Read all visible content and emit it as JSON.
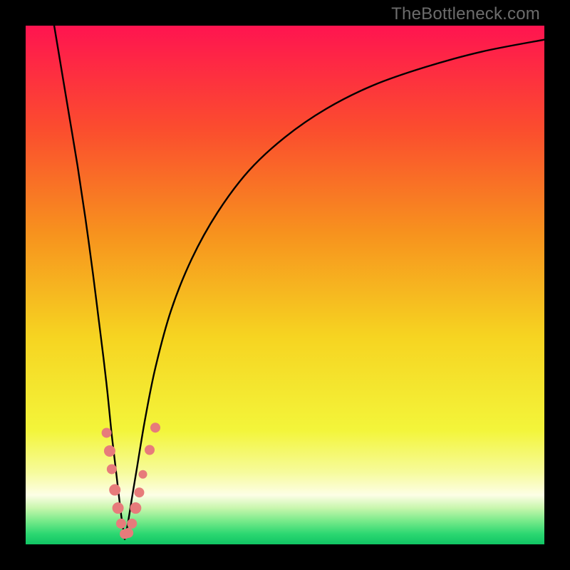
{
  "watermark": "TheBottleneck.com",
  "chart_data": {
    "type": "line",
    "title": "",
    "xlabel": "",
    "ylabel": "",
    "xlim": [
      0,
      100
    ],
    "ylim": [
      0,
      100
    ],
    "gradient_stops": [
      {
        "offset": 0,
        "color": "#ff1450"
      },
      {
        "offset": 0.2,
        "color": "#fb4d2e"
      },
      {
        "offset": 0.4,
        "color": "#f7921e"
      },
      {
        "offset": 0.6,
        "color": "#f6d421"
      },
      {
        "offset": 0.78,
        "color": "#f3f53a"
      },
      {
        "offset": 0.86,
        "color": "#f6fb9a"
      },
      {
        "offset": 0.905,
        "color": "#fdfee6"
      },
      {
        "offset": 0.93,
        "color": "#c8f6ad"
      },
      {
        "offset": 0.955,
        "color": "#77ea8a"
      },
      {
        "offset": 0.98,
        "color": "#2bd771"
      },
      {
        "offset": 1.0,
        "color": "#11c564"
      }
    ],
    "series": [
      {
        "name": "left-branch",
        "x": [
          5.5,
          7,
          8.5,
          10,
          11.5,
          13,
          14,
          15,
          15.8,
          16.5,
          17.2,
          17.9,
          18.5,
          19.1
        ],
        "y": [
          100,
          91,
          82,
          73,
          63,
          52,
          44,
          36,
          29,
          22,
          16,
          10,
          5,
          1
        ]
      },
      {
        "name": "right-branch",
        "x": [
          19.1,
          19.7,
          20.5,
          21.5,
          23,
          25,
          28,
          32,
          37,
          43,
          50,
          58,
          67,
          77,
          88,
          100
        ],
        "y": [
          1,
          4,
          9,
          15,
          24,
          34,
          45,
          55,
          64,
          72,
          78.5,
          84,
          88.5,
          92,
          95,
          97.3
        ]
      }
    ],
    "markers": [
      {
        "x": 15.6,
        "y": 21.5,
        "r": 7
      },
      {
        "x": 16.2,
        "y": 18.0,
        "r": 8
      },
      {
        "x": 16.6,
        "y": 14.5,
        "r": 7
      },
      {
        "x": 17.2,
        "y": 10.5,
        "r": 8
      },
      {
        "x": 17.8,
        "y": 7.0,
        "r": 8
      },
      {
        "x": 18.4,
        "y": 4.0,
        "r": 7
      },
      {
        "x": 19.1,
        "y": 2.0,
        "r": 7
      },
      {
        "x": 19.8,
        "y": 2.2,
        "r": 7
      },
      {
        "x": 20.5,
        "y": 4.0,
        "r": 7
      },
      {
        "x": 21.2,
        "y": 7.0,
        "r": 8
      },
      {
        "x": 21.9,
        "y": 10.0,
        "r": 7
      },
      {
        "x": 22.6,
        "y": 13.5,
        "r": 6
      },
      {
        "x": 23.9,
        "y": 18.2,
        "r": 7
      },
      {
        "x": 25.0,
        "y": 22.5,
        "r": 7
      }
    ]
  }
}
